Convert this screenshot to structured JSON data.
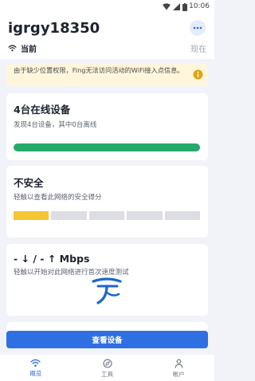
{
  "statusbar": {
    "time": "10:06",
    "icons": [
      "wifi-icon",
      "signal-icon",
      "battery-icon"
    ]
  },
  "header": {
    "title": "igrgy18350",
    "more_icon": "more-horizontal-icon",
    "network_icon": "wifi-icon",
    "network_label": "当前",
    "network_status": "现在"
  },
  "alert": {
    "text": "由于缺少位置权限，Fing无法访问活动的WiFi接入点信息。",
    "icon": "info-icon"
  },
  "cards": {
    "devices": {
      "title": "4台在线设备",
      "desc": "发现4台设备，其中0台离线",
      "online_fraction": 1.0,
      "bar_color": "#27a96b"
    },
    "security": {
      "title": "不安全",
      "desc": "轻触以查看此网络的安全得分",
      "segments_total": 5,
      "segments_active": 1,
      "active_color": "#f4c534"
    },
    "speed": {
      "title": "- ↓ / - ↑ Mbps",
      "desc": "轻触以开始对此网络进行首次速度测试",
      "provider_logo": "china-telecom-logo"
    }
  },
  "primary_button": {
    "label": "查看设备"
  },
  "bottom_nav": {
    "items": [
      {
        "label": "概览",
        "icon": "wifi-icon",
        "active": true
      },
      {
        "label": "工具",
        "icon": "compass-icon",
        "active": false
      },
      {
        "label": "帐户",
        "icon": "person-icon",
        "active": false
      }
    ]
  },
  "colors": {
    "accent": "#2f6fe3",
    "background": "#f1f3f8",
    "warning_bg": "#fff6dc"
  }
}
